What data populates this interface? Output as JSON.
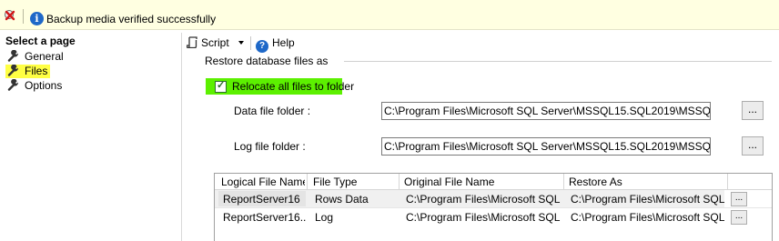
{
  "notification": {
    "message": "Backup media verified successfully",
    "close_icon": "error-close-icon",
    "info_icon": "info-icon"
  },
  "nav": {
    "heading": "Select a page",
    "items": [
      {
        "label": "General",
        "icon": "wrench-icon",
        "selected": false
      },
      {
        "label": "Files",
        "icon": "wrench-icon",
        "selected": true
      },
      {
        "label": "Options",
        "icon": "wrench-icon",
        "selected": false
      }
    ]
  },
  "toolbar": {
    "script_label": "Script",
    "help_label": "Help",
    "help_icon": "help-icon"
  },
  "restore_files": {
    "group_label": "Restore database files as",
    "relocate_label": "Relocate all files to folder",
    "relocate_checked": true,
    "data_label": "Data file folder :",
    "data_value": "C:\\Program Files\\Microsoft SQL Server\\MSSQL15.SQL2019\\MSSQL\\DAT.",
    "log_label": "Log file folder :",
    "log_value": "C:\\Program Files\\Microsoft SQL Server\\MSSQL15.SQL2019\\MSSQL\\DAT.",
    "browse_label": "...",
    "highlight_color": "#5cf000"
  },
  "grid": {
    "headers": [
      "Logical File Name",
      "File Type",
      "Original File Name",
      "Restore As"
    ],
    "rows": [
      {
        "logical": "ReportServer16",
        "type": "Rows Data",
        "original": "C:\\Program Files\\Microsoft SQL ...",
        "restore": "C:\\Program Files\\Microsoft SQL ...",
        "button": "..."
      },
      {
        "logical": "ReportServer16...",
        "type": "Log",
        "original": "C:\\Program Files\\Microsoft SQL ...",
        "restore": "C:\\Program Files\\Microsoft SQL ...",
        "button": "..."
      }
    ]
  }
}
